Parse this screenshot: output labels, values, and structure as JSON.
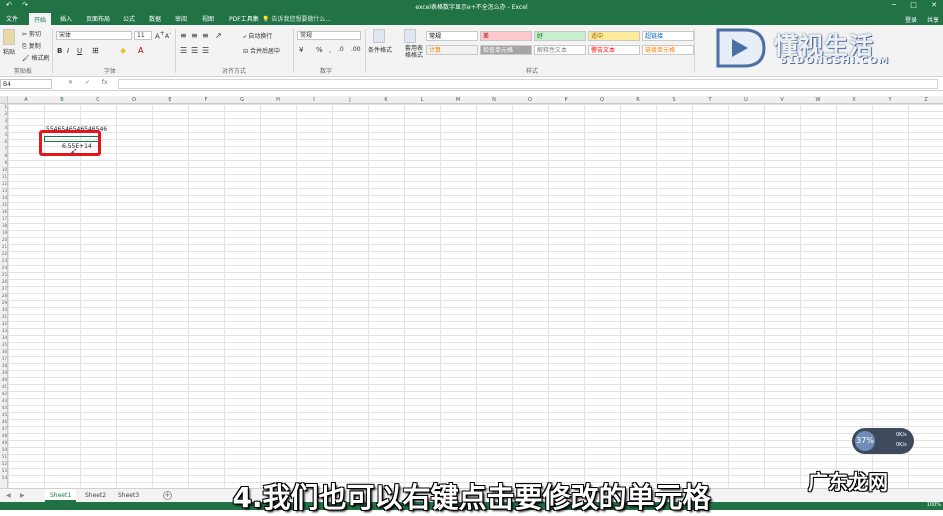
{
  "titlebar": {
    "doc_title": "excel表格数字显示e+不全怎么办 - Excel",
    "quick_access": [
      "↶",
      "↷"
    ],
    "window_controls": [
      "─",
      "□",
      "✕"
    ]
  },
  "ribbon_tabs": [
    "文件",
    "开始",
    "插入",
    "页面布局",
    "公式",
    "数据",
    "审阅",
    "视图",
    "PDF工具集"
  ],
  "active_tab": "开始",
  "tell_me": "告诉我您想要做什么...",
  "signin": "登录",
  "share": "共享",
  "clipboard": {
    "paste": "粘贴",
    "cut": "剪切",
    "copy": "复制",
    "format_painter": "格式刷",
    "group": "剪贴板"
  },
  "font": {
    "name": "宋体",
    "size": "11",
    "bold": "B",
    "italic": "I",
    "underline": "U",
    "group": "字体"
  },
  "alignment": {
    "wrap": "自动换行",
    "merge": "合并后居中",
    "group": "对齐方式"
  },
  "number": {
    "format": "常规",
    "group": "数字"
  },
  "styles": {
    "conditional": "条件格式",
    "table_format": "套用表格格式",
    "group": "样式",
    "cells": [
      {
        "label": "常规",
        "bg": "#ffffff",
        "fg": "#000000"
      },
      {
        "label": "差",
        "bg": "#ffc7ce",
        "fg": "#9c0006"
      },
      {
        "label": "好",
        "bg": "#c6efce",
        "fg": "#006100"
      },
      {
        "label": "适中",
        "bg": "#ffeb9c",
        "fg": "#9c5700"
      },
      {
        "label": "超链接",
        "bg": "#ffffff",
        "fg": "#0563c1"
      },
      {
        "label": "计算",
        "bg": "#f2f2f2",
        "fg": "#fa7d00"
      },
      {
        "label": "检查单元格",
        "bg": "#a5a5a5",
        "fg": "#ffffff"
      },
      {
        "label": "解释性文本",
        "bg": "#ffffff",
        "fg": "#7f7f7f"
      },
      {
        "label": "警告文本",
        "bg": "#ffffff",
        "fg": "#ff0000"
      },
      {
        "label": "链接单元格",
        "bg": "#ffffff",
        "fg": "#fa7d00"
      }
    ]
  },
  "formula_bar": {
    "name_box": "B4",
    "fx": [
      "✕",
      "✓",
      "fx"
    ],
    "content": ""
  },
  "columns": [
    "A",
    "B",
    "C",
    "D",
    "E",
    "F",
    "G",
    "H",
    "I",
    "J",
    "K",
    "L",
    "M",
    "N",
    "O",
    "P",
    "Q",
    "R",
    "S",
    "T",
    "U",
    "V",
    "W",
    "X",
    "Y",
    "Z"
  ],
  "selected_column": "B",
  "rows": [
    "1",
    "2",
    "3",
    "4",
    "5",
    "6",
    "7",
    "8",
    "9",
    "10",
    "11",
    "12",
    "13",
    "14",
    "15",
    "16",
    "17",
    "18",
    "19",
    "20",
    "21",
    "22",
    "23",
    "24",
    "25",
    "26",
    "27",
    "28",
    "29",
    "30",
    "31",
    "32",
    "33",
    "34",
    "35",
    "36",
    "37",
    "38",
    "39",
    "40",
    "41",
    "42",
    "43",
    "44",
    "45",
    "46",
    "47",
    "48",
    "49",
    "50",
    "51",
    "52",
    "53",
    "54"
  ],
  "cells": {
    "b3": "5546546546546546",
    "b5": "6.55E+14"
  },
  "sheets": [
    "Sheet1",
    "Sheet2",
    "Sheet3"
  ],
  "active_sheet": "Sheet1",
  "zoom": "100%",
  "widget": {
    "percent": "37%",
    "speed_up": "0K/s",
    "speed_down": "0K/s"
  },
  "subtitle": "4.我们也可以右键点击要修改的单元格",
  "watermark": {
    "brand": "懂视生活",
    "domain": "51DONGSHI.COM",
    "bottom": "广东龙网"
  }
}
